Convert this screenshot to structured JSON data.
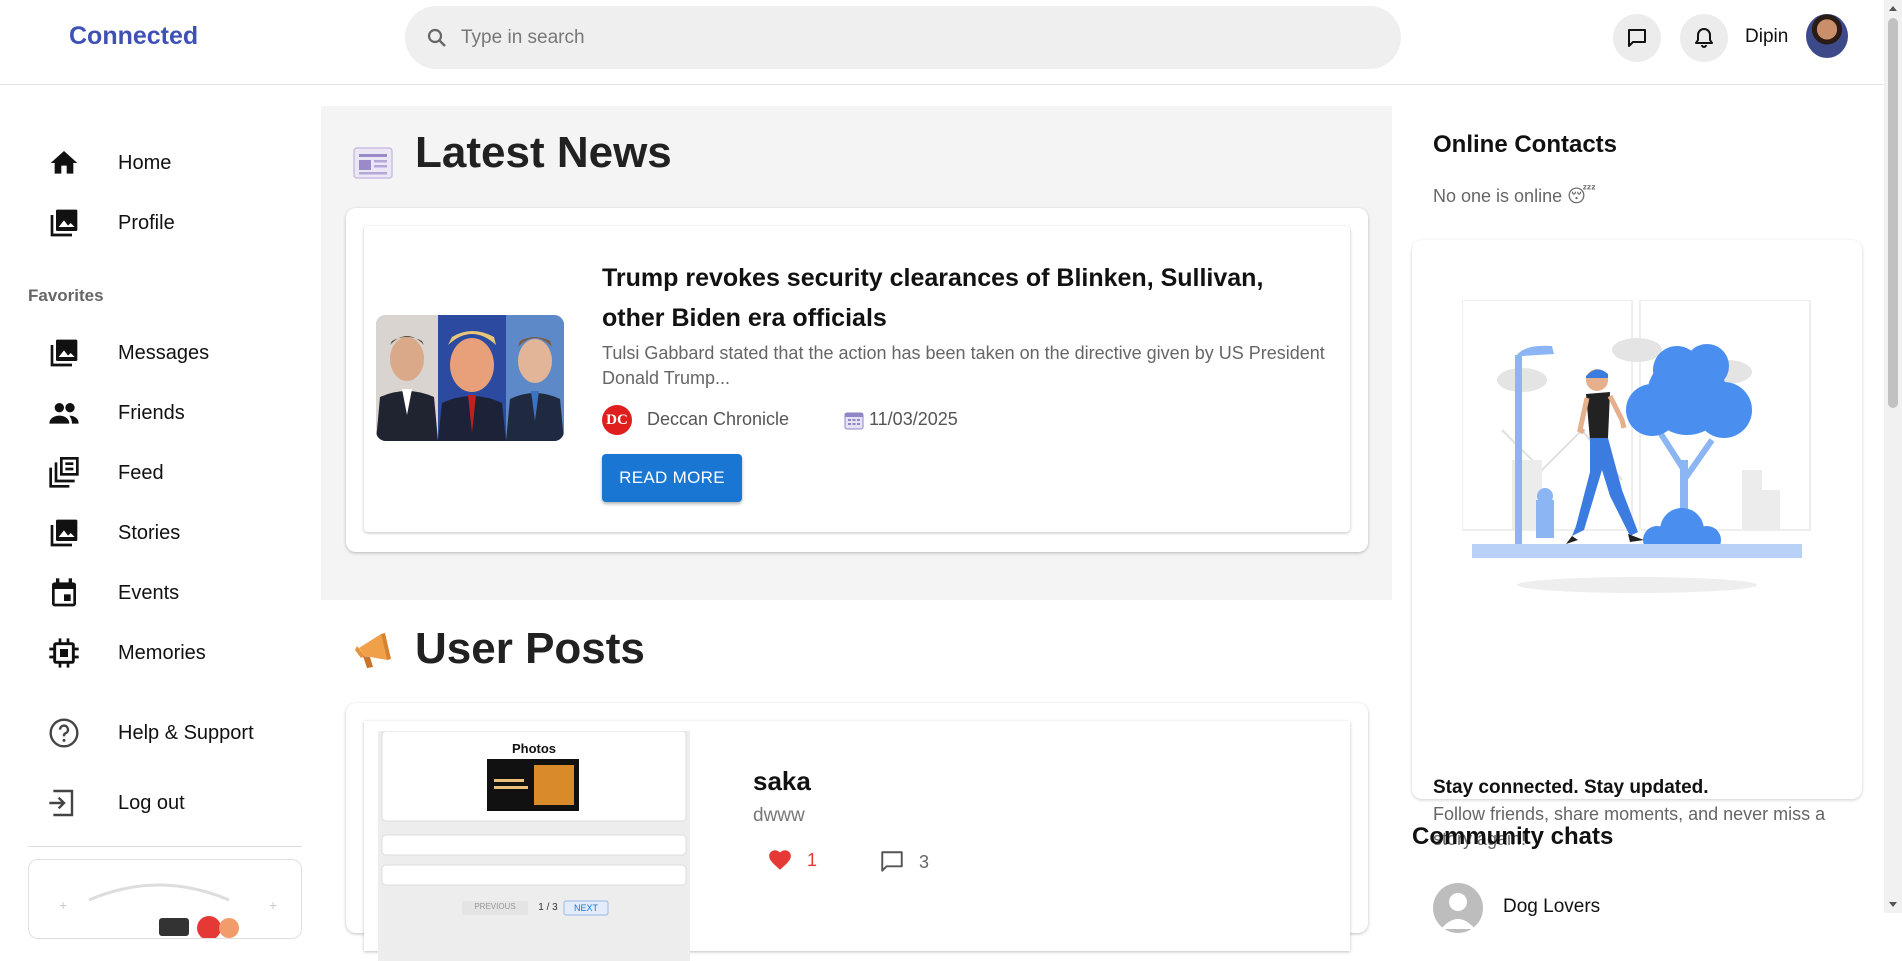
{
  "app": {
    "brand": "Connected"
  },
  "search": {
    "placeholder": "Type in search"
  },
  "header": {
    "username": "Dipin"
  },
  "sidebar": {
    "top_items": [
      {
        "label": "Home",
        "icon": "home-icon"
      },
      {
        "label": "Profile",
        "icon": "image-icon"
      }
    ],
    "favorites_label": "Favorites",
    "fav_items": [
      {
        "label": "Messages",
        "icon": "image-icon"
      },
      {
        "label": "Friends",
        "icon": "people-icon"
      },
      {
        "label": "Feed",
        "icon": "library-icon"
      },
      {
        "label": "Stories",
        "icon": "image-icon"
      },
      {
        "label": "Events",
        "icon": "event-icon"
      },
      {
        "label": "Memories",
        "icon": "chip-icon"
      }
    ],
    "bottom_items": [
      {
        "label": "Help & Support",
        "icon": "help-icon"
      },
      {
        "label": "Log out",
        "icon": "logout-icon"
      }
    ]
  },
  "news": {
    "section_title": "Latest News",
    "article": {
      "title": "Trump revokes security clearances of Blinken, Sullivan, other Biden era officials",
      "description": "Tulsi Gabbard stated that the action has been taken on the directive given by US President Donald Trump...",
      "source_logo": "DC",
      "source": "Deccan Chronicle",
      "date": "11/03/2025",
      "button": "READ MORE"
    }
  },
  "posts": {
    "section_title": "User Posts",
    "items": [
      {
        "thumb_title": "Photos",
        "thumb_pager": "1 / 3",
        "thumb_next": "NEXT",
        "thumb_prev": "PREVIOUS",
        "username": "saka",
        "text": "dwww",
        "likes": "1",
        "comments": "3"
      }
    ]
  },
  "right": {
    "online_title": "Online Contacts",
    "online_empty": "No one is online",
    "online_emoji": "😴",
    "tagline": "Stay connected. Stay updated.",
    "tagline_desc": "Follow friends, share moments, and never miss a story again!",
    "community_title": "Community chats",
    "communities": [
      {
        "name": "Dog Lovers"
      }
    ]
  },
  "colors": {
    "brand": "#3f51b5",
    "button": "#1976d2",
    "like": "#e53935",
    "illustration_blue": "#4a8ff0"
  }
}
